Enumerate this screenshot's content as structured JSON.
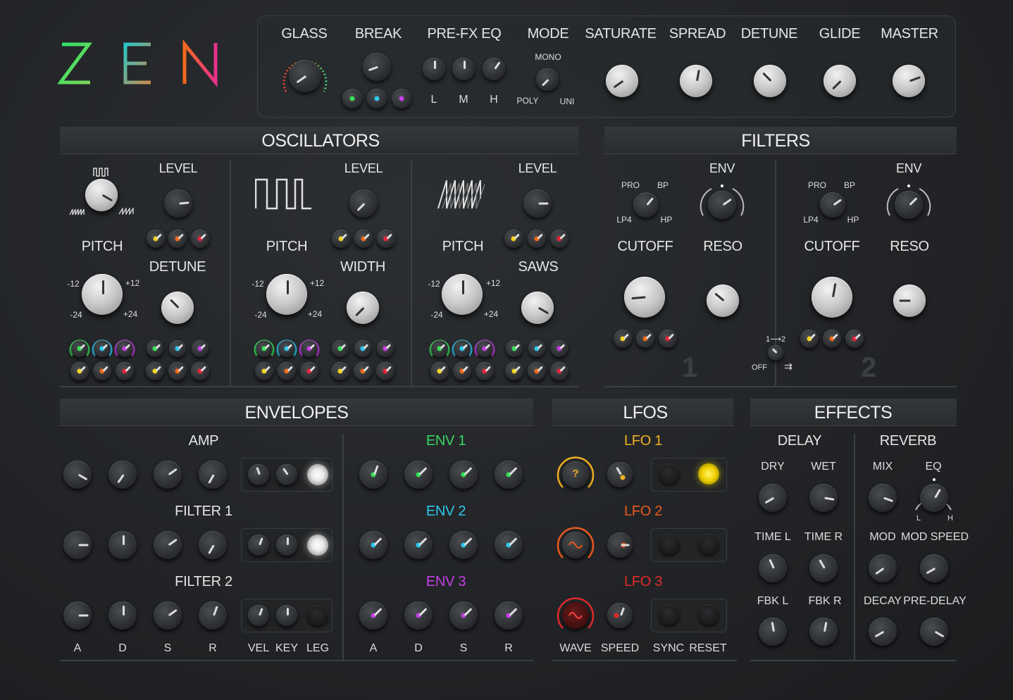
{
  "logo": {
    "letters": [
      "Z",
      "E",
      "N"
    ]
  },
  "top": {
    "glass": "GLASS",
    "break": "BREAK",
    "prefx": "PRE-FX EQ",
    "mode": "MODE",
    "saturate": "SATURATE",
    "spread": "SPREAD",
    "detune": "DETUNE",
    "glide": "GLIDE",
    "master": "MASTER",
    "eq_l": "L",
    "eq_m": "M",
    "eq_h": "H",
    "mode_mono": "MONO",
    "mode_poly": "POLY",
    "mode_uni": "UNI"
  },
  "sections": {
    "osc": "OSCILLATORS",
    "filters": "FILTERS",
    "env": "ENVELOPES",
    "lfos": "LFOS",
    "effects": "EFFECTS"
  },
  "osc": {
    "level": "LEVEL",
    "pitch": "PITCH",
    "detune": "DETUNE",
    "width": "WIDTH",
    "saws": "SAWS",
    "m12": "-12",
    "p12": "+12",
    "m24": "-24",
    "p24": "+24"
  },
  "filters": {
    "env": "ENV",
    "cutoff": "CUTOFF",
    "reso": "RESO",
    "pro": "PRO",
    "bp": "BP",
    "lp4": "LP4",
    "hp": "HP",
    "num1": "1",
    "num2": "2",
    "route": "1⟶2",
    "off": "OFF",
    "par": "⇉"
  },
  "env": {
    "amp": "AMP",
    "f1": "FILTER 1",
    "f2": "FILTER 2",
    "e1": "ENV 1",
    "e2": "ENV 2",
    "e3": "ENV 3",
    "a": "A",
    "d": "D",
    "s": "S",
    "r": "R",
    "vel": "VEL",
    "key": "KEY",
    "leg": "LEG"
  },
  "lfo": {
    "l1": "LFO 1",
    "l2": "LFO 2",
    "l3": "LFO 3",
    "wave": "WAVE",
    "speed": "SPEED",
    "sync": "SYNC",
    "reset": "RESET",
    "q": "?"
  },
  "fx": {
    "delay": "DELAY",
    "reverb": "REVERB",
    "dry": "DRY",
    "wet": "WET",
    "mix": "MIX",
    "eq": "EQ",
    "timel": "TIME L",
    "timer": "TIME R",
    "mod": "MOD",
    "modspeed": "MOD SPEED",
    "fbkl": "FBK L",
    "fbkr": "FBK R",
    "decay": "DECAY",
    "predelay": "PRE-DELAY",
    "eq_l": "L",
    "eq_h": "H"
  },
  "colors": {
    "green": "#39e05a",
    "cyan": "#2fc8ee",
    "magenta": "#c640e6",
    "yellow": "#f5d21c",
    "orange": "#f06a1a",
    "red": "#e8243a",
    "lfo1": "#f0b020",
    "lfo2": "#ea5a1e",
    "lfo3": "#e22a2a"
  }
}
